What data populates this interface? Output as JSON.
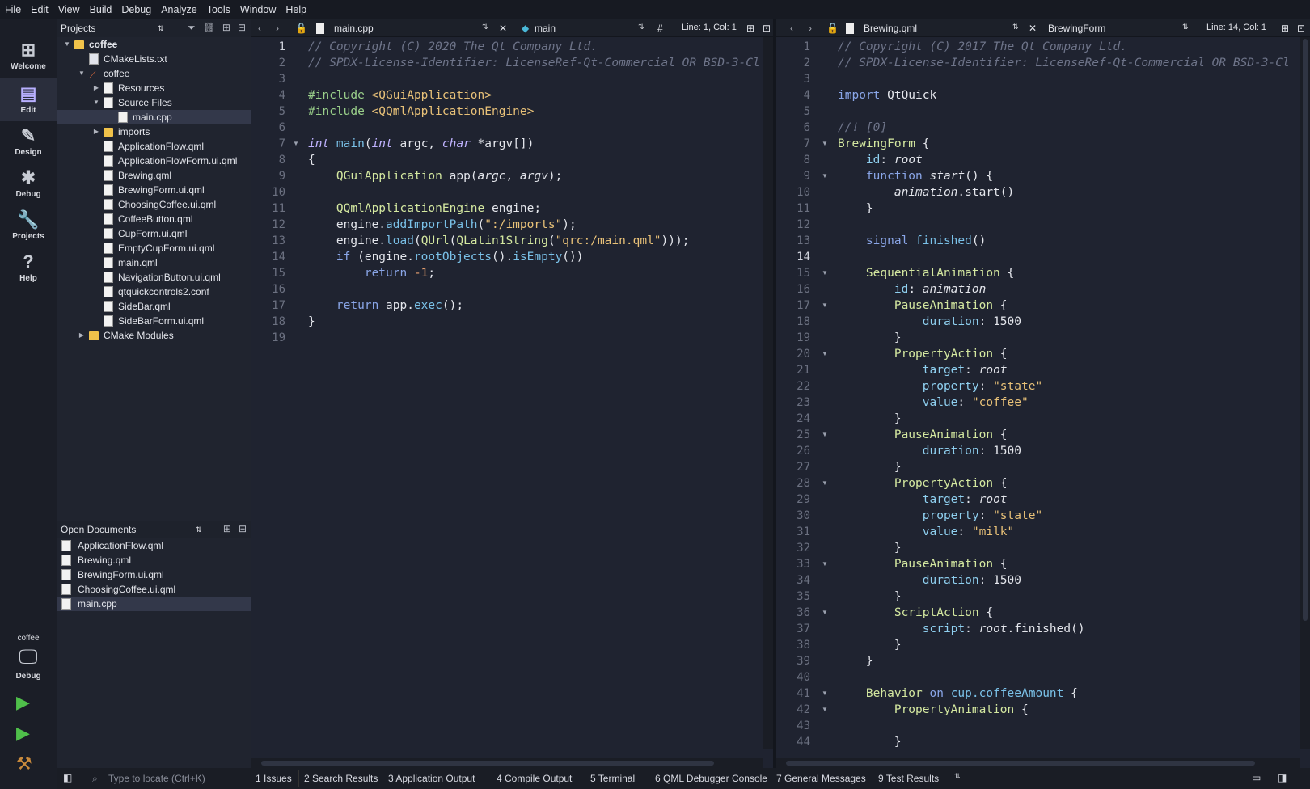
{
  "menu": [
    "File",
    "Edit",
    "View",
    "Build",
    "Debug",
    "Analyze",
    "Tools",
    "Window",
    "Help"
  ],
  "modes": [
    {
      "label": "Welcome",
      "icon": "⊞"
    },
    {
      "label": "Edit",
      "icon": "▤"
    },
    {
      "label": "Design",
      "icon": "✎"
    },
    {
      "label": "Debug",
      "icon": "✱"
    },
    {
      "label": "Projects",
      "icon": "🔧"
    },
    {
      "label": "Help",
      "icon": "?"
    }
  ],
  "kit": {
    "project": "coffee",
    "config": "Debug"
  },
  "projects_title": "Projects",
  "open_docs_title": "Open Documents",
  "tree": [
    {
      "label": "coffee",
      "depth": 0,
      "arrow": "▼",
      "icon": "folder",
      "bold": true
    },
    {
      "label": "CMakeLists.txt",
      "depth": 1,
      "arrow": "",
      "icon": "cmake"
    },
    {
      "label": "coffee",
      "depth": 1,
      "arrow": "▼",
      "icon": "none"
    },
    {
      "label": "Resources",
      "depth": 2,
      "arrow": "▶",
      "icon": "doc"
    },
    {
      "label": "Source Files",
      "depth": 2,
      "arrow": "▼",
      "icon": "doc"
    },
    {
      "label": "main.cpp",
      "depth": 3,
      "arrow": "",
      "icon": "doc",
      "selected": true
    },
    {
      "label": "imports",
      "depth": 2,
      "arrow": "▶",
      "icon": "folder"
    },
    {
      "label": "ApplicationFlow.qml",
      "depth": 2,
      "arrow": "",
      "icon": "doc"
    },
    {
      "label": "ApplicationFlowForm.ui.qml",
      "depth": 2,
      "arrow": "",
      "icon": "doc"
    },
    {
      "label": "Brewing.qml",
      "depth": 2,
      "arrow": "",
      "icon": "doc"
    },
    {
      "label": "BrewingForm.ui.qml",
      "depth": 2,
      "arrow": "",
      "icon": "doc"
    },
    {
      "label": "ChoosingCoffee.ui.qml",
      "depth": 2,
      "arrow": "",
      "icon": "doc"
    },
    {
      "label": "CoffeeButton.qml",
      "depth": 2,
      "arrow": "",
      "icon": "doc"
    },
    {
      "label": "CupForm.ui.qml",
      "depth": 2,
      "arrow": "",
      "icon": "doc"
    },
    {
      "label": "EmptyCupForm.ui.qml",
      "depth": 2,
      "arrow": "",
      "icon": "doc"
    },
    {
      "label": "main.qml",
      "depth": 2,
      "arrow": "",
      "icon": "doc"
    },
    {
      "label": "NavigationButton.ui.qml",
      "depth": 2,
      "arrow": "",
      "icon": "doc"
    },
    {
      "label": "qtquickcontrols2.conf",
      "depth": 2,
      "arrow": "",
      "icon": "doc"
    },
    {
      "label": "SideBar.qml",
      "depth": 2,
      "arrow": "",
      "icon": "doc"
    },
    {
      "label": "SideBarForm.ui.qml",
      "depth": 2,
      "arrow": "",
      "icon": "doc"
    },
    {
      "label": "CMake Modules",
      "depth": 1,
      "arrow": "▶",
      "icon": "folder"
    }
  ],
  "open_docs": [
    {
      "label": "ApplicationFlow.qml"
    },
    {
      "label": "Brewing.qml"
    },
    {
      "label": "BrewingForm.ui.qml"
    },
    {
      "label": "ChoosingCoffee.ui.qml"
    },
    {
      "label": "main.cpp",
      "selected": true
    }
  ],
  "left_editor": {
    "file": "main.cpp",
    "symbol": "main",
    "hash": "#",
    "position": "Line: 1, Col: 1",
    "current_line": 0,
    "folds": [
      7
    ],
    "lines": [
      [
        [
          "cm",
          "// Copyright (C) 2020 The Qt Company Ltd."
        ]
      ],
      [
        [
          "cm",
          "// SPDX-License-Identifier: LicenseRef-Qt-Commercial OR BSD-3-Cl"
        ]
      ],
      [],
      [
        [
          "pp",
          "#include "
        ],
        [
          "str",
          "<QGuiApplication>"
        ]
      ],
      [
        [
          "pp",
          "#include "
        ],
        [
          "str",
          "<QQmlApplicationEngine>"
        ]
      ],
      [],
      [
        [
          "kwi",
          "int "
        ],
        [
          "fn",
          "main"
        ],
        [
          "id",
          "("
        ],
        [
          "kwi",
          "int "
        ],
        [
          "id",
          "argc, "
        ],
        [
          "kwi",
          "char "
        ],
        [
          "id",
          "*argv[])"
        ]
      ],
      [
        [
          "id",
          "{"
        ]
      ],
      [
        [
          "ty",
          "    QGuiApplication "
        ],
        [
          "id",
          "app("
        ],
        [
          "it",
          "argc"
        ],
        [
          "id",
          ", "
        ],
        [
          "it",
          "argv"
        ],
        [
          "id",
          ");"
        ]
      ],
      [],
      [
        [
          "ty",
          "    QQmlApplicationEngine "
        ],
        [
          "id",
          "engine;"
        ]
      ],
      [
        [
          "id",
          "    engine."
        ],
        [
          "fn",
          "addImportPath"
        ],
        [
          "id",
          "("
        ],
        [
          "str",
          "\":/imports\""
        ],
        [
          "id",
          ");"
        ]
      ],
      [
        [
          "id",
          "    engine."
        ],
        [
          "fn",
          "load"
        ],
        [
          "id",
          "("
        ],
        [
          "ty",
          "QUrl"
        ],
        [
          "id",
          "("
        ],
        [
          "ty",
          "QLatin1String"
        ],
        [
          "id",
          "("
        ],
        [
          "str",
          "\"qrc:/main.qml\""
        ],
        [
          "id",
          ")));"
        ]
      ],
      [
        [
          "kw",
          "    if "
        ],
        [
          "id",
          "(engine."
        ],
        [
          "fn",
          "rootObjects"
        ],
        [
          "id",
          "()."
        ],
        [
          "fn",
          "isEmpty"
        ],
        [
          "id",
          "())"
        ]
      ],
      [
        [
          "kw",
          "        return "
        ],
        [
          "num",
          "-1"
        ],
        [
          "id",
          ";"
        ]
      ],
      [],
      [
        [
          "kw",
          "    return "
        ],
        [
          "id",
          "app."
        ],
        [
          "fn",
          "exec"
        ],
        [
          "id",
          "();"
        ]
      ],
      [
        [
          "id",
          "}"
        ]
      ],
      []
    ]
  },
  "right_editor": {
    "file": "Brewing.qml",
    "symbol": "BrewingForm",
    "position": "Line: 14, Col: 1",
    "current_line": 13,
    "folds": [
      7,
      9,
      15,
      17,
      20,
      25,
      28,
      33,
      36,
      41,
      42
    ],
    "lines": [
      [
        [
          "cm",
          "// Copyright (C) 2017 The Qt Company Ltd."
        ]
      ],
      [
        [
          "cm",
          "// SPDX-License-Identifier: LicenseRef-Qt-Commercial OR BSD-3-Cl"
        ]
      ],
      [],
      [
        [
          "kw",
          "import "
        ],
        [
          "id",
          "QtQuick"
        ]
      ],
      [],
      [
        [
          "cm",
          "//! [0]"
        ]
      ],
      [
        [
          "ty",
          "BrewingForm "
        ],
        [
          "id",
          "{"
        ]
      ],
      [
        [
          "prop",
          "    id"
        ],
        [
          "id",
          ": "
        ],
        [
          "it",
          "root"
        ]
      ],
      [
        [
          "kw",
          "    function "
        ],
        [
          "it",
          "start"
        ],
        [
          "id",
          "() {"
        ]
      ],
      [
        [
          "it",
          "        animation"
        ],
        [
          "id",
          ".start()"
        ]
      ],
      [
        [
          "id",
          "    }"
        ]
      ],
      [],
      [
        [
          "kw",
          "    signal "
        ],
        [
          "fn",
          "finished"
        ],
        [
          "id",
          "()"
        ]
      ],
      [],
      [
        [
          "ty",
          "    SequentialAnimation "
        ],
        [
          "id",
          "{"
        ]
      ],
      [
        [
          "prop",
          "        id"
        ],
        [
          "id",
          ": "
        ],
        [
          "it",
          "animation"
        ]
      ],
      [
        [
          "ty",
          "        PauseAnimation "
        ],
        [
          "id",
          "{"
        ]
      ],
      [
        [
          "prop",
          "            duration"
        ],
        [
          "id",
          ": 1500"
        ]
      ],
      [
        [
          "id",
          "        }"
        ]
      ],
      [
        [
          "ty",
          "        PropertyAction "
        ],
        [
          "id",
          "{"
        ]
      ],
      [
        [
          "prop",
          "            target"
        ],
        [
          "id",
          ": "
        ],
        [
          "it",
          "root"
        ]
      ],
      [
        [
          "prop",
          "            property"
        ],
        [
          "id",
          ": "
        ],
        [
          "str",
          "\"state\""
        ]
      ],
      [
        [
          "prop",
          "            value"
        ],
        [
          "id",
          ": "
        ],
        [
          "str",
          "\"coffee\""
        ]
      ],
      [
        [
          "id",
          "        }"
        ]
      ],
      [
        [
          "ty",
          "        PauseAnimation "
        ],
        [
          "id",
          "{"
        ]
      ],
      [
        [
          "prop",
          "            duration"
        ],
        [
          "id",
          ": 1500"
        ]
      ],
      [
        [
          "id",
          "        }"
        ]
      ],
      [
        [
          "ty",
          "        PropertyAction "
        ],
        [
          "id",
          "{"
        ]
      ],
      [
        [
          "prop",
          "            target"
        ],
        [
          "id",
          ": "
        ],
        [
          "it",
          "root"
        ]
      ],
      [
        [
          "prop",
          "            property"
        ],
        [
          "id",
          ": "
        ],
        [
          "str",
          "\"state\""
        ]
      ],
      [
        [
          "prop",
          "            value"
        ],
        [
          "id",
          ": "
        ],
        [
          "str",
          "\"milk\""
        ]
      ],
      [
        [
          "id",
          "        }"
        ]
      ],
      [
        [
          "ty",
          "        PauseAnimation "
        ],
        [
          "id",
          "{"
        ]
      ],
      [
        [
          "prop",
          "            duration"
        ],
        [
          "id",
          ": 1500"
        ]
      ],
      [
        [
          "id",
          "        }"
        ]
      ],
      [
        [
          "ty",
          "        ScriptAction "
        ],
        [
          "id",
          "{"
        ]
      ],
      [
        [
          "prop",
          "            script"
        ],
        [
          "id",
          ": "
        ],
        [
          "it",
          "root"
        ],
        [
          "id",
          ".finished()"
        ]
      ],
      [
        [
          "id",
          "        }"
        ]
      ],
      [
        [
          "id",
          "    }"
        ]
      ],
      [],
      [
        [
          "ty",
          "    Behavior "
        ],
        [
          "kw",
          "on "
        ],
        [
          "fn",
          "cup.coffeeAmount "
        ],
        [
          "id",
          "{"
        ]
      ],
      [
        [
          "ty",
          "        PropertyAnimation "
        ],
        [
          "id",
          "{"
        ]
      ],
      [],
      [
        [
          "id",
          "        }"
        ]
      ]
    ]
  },
  "locate_placeholder": "Type to locate (Ctrl+K)",
  "output_tabs": [
    "1  Issues",
    "2  Search Results",
    "3  Application Output",
    "4  Compile Output",
    "5  Terminal",
    "6  QML Debugger Console",
    "7  General Messages",
    "9  Test Results"
  ],
  "colors": {
    "background": "#1f2330",
    "accent": "#b8b0ff",
    "run": "#4fbf4a"
  }
}
